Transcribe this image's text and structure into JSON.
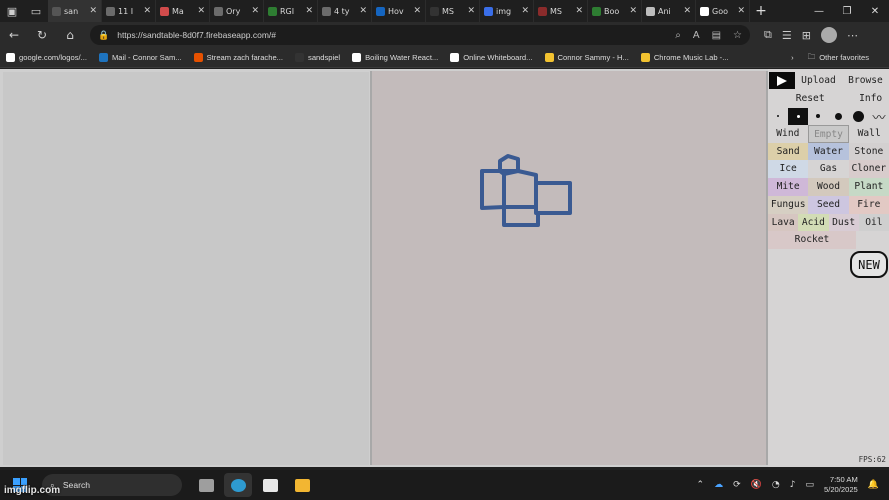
{
  "tabs": [
    {
      "label": "san",
      "color": "#555555",
      "active": true
    },
    {
      "label": "11 I",
      "color": "#6b6b6b"
    },
    {
      "label": "Ma",
      "color": "#d14b4b"
    },
    {
      "label": "Ory",
      "color": "#6b6b6b"
    },
    {
      "label": "RGI",
      "color": "#2e7d32"
    },
    {
      "label": "4 ty",
      "color": "#6b6b6b"
    },
    {
      "label": "Hov",
      "color": "#1565c0"
    },
    {
      "label": "MS",
      "color": "#333333"
    },
    {
      "label": "img",
      "color": "#3a6ee8"
    },
    {
      "label": "MS",
      "color": "#8a2b2b"
    },
    {
      "label": "Boo",
      "color": "#2e7d32"
    },
    {
      "label": "Ani",
      "color": "#bdbdbd"
    },
    {
      "label": "Goo",
      "color": "#ffffff"
    }
  ],
  "address": {
    "url": "https://sandtable-8d0f7.firebaseapp.com/#"
  },
  "favorites": [
    {
      "label": "google.com/logos/...",
      "color": "#ffffff"
    },
    {
      "label": "Mail - Connor Sam...",
      "color": "#1e73be"
    },
    {
      "label": "Stream zach farache...",
      "color": "#e65100"
    },
    {
      "label": "sandspiel",
      "color": "#333333"
    },
    {
      "label": "Boiling Water React...",
      "color": "#ffffff"
    },
    {
      "label": "Online Whiteboard...",
      "color": "#ffffff"
    },
    {
      "label": "Connor Sammy - H...",
      "color": "#f2c230"
    },
    {
      "label": "Chrome Music Lab -...",
      "color": "#f2c230"
    }
  ],
  "other_favorites": "Other favorites",
  "panel": {
    "upload": "Upload",
    "browse": "Browse",
    "reset": "Reset",
    "info": "Info",
    "fps": "FPS:62",
    "new_badge": "NEW",
    "elements": [
      [
        {
          "label": "Wind",
          "bg": "#d6d4d4"
        },
        {
          "label": "Empty",
          "bg": "#c9c9c9"
        },
        {
          "label": "Wall",
          "bg": "#d6d4d4"
        }
      ],
      [
        {
          "label": "Sand",
          "bg": "#dccfa9"
        },
        {
          "label": "Water",
          "bg": "#b6c2dc"
        },
        {
          "label": "Stone",
          "bg": "#d3d0d0"
        }
      ],
      [
        {
          "label": "Ice",
          "bg": "#cfd9e6"
        },
        {
          "label": "Gas",
          "bg": "#d6d4d4"
        },
        {
          "label": "Cloner",
          "bg": "#d8cccc"
        }
      ],
      [
        {
          "label": "Mite",
          "bg": "#cfb8d8"
        },
        {
          "label": "Wood",
          "bg": "#d3c9bd"
        },
        {
          "label": "Plant",
          "bg": "#c6d9c6"
        }
      ],
      [
        {
          "label": "Fungus",
          "bg": "#d6cfc3"
        },
        {
          "label": "Seed",
          "bg": "#cdc6e0"
        },
        {
          "label": "Fire",
          "bg": "#e2c9c4"
        }
      ],
      [
        {
          "label": "Lava",
          "bg": "#d6c6c1"
        },
        {
          "label": "Acid",
          "bg": "#d2dcb5"
        },
        {
          "label": "Dust",
          "bg": "#d8ccd4"
        },
        {
          "label": "Oil",
          "bg": "#cfcfcf"
        }
      ],
      [
        {
          "label": "Rocket",
          "bg": "#d8c8c8"
        }
      ]
    ]
  },
  "drawing": {
    "stroke": "#3a5a92"
  },
  "taskbar": {
    "search": "Search",
    "time": "7:50 AM",
    "date": "5/20/2025"
  },
  "watermark": "imgflip.com"
}
